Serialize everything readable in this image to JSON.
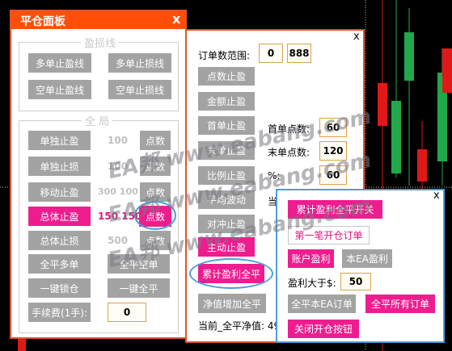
{
  "panel1": {
    "title": "平仓面板",
    "close": "x",
    "group1_label": "盈损线",
    "btn_multi_tp": "多单止盈线",
    "btn_multi_sl": "多单止损线",
    "btn_short_tp": "空单止盈线",
    "btn_short_sl": "空单止损线",
    "group2_label": "全 局",
    "row_single_tp": {
      "label": "单独止盈",
      "value": "100",
      "unit": "点数"
    },
    "row_single_sl": {
      "label": "单独止损",
      "value": "100",
      "unit": "点数"
    },
    "row_move_tp": {
      "label": "移动止盈",
      "value": "300 100",
      "unit": "点数"
    },
    "row_total_tp": {
      "label": "总体止盈",
      "value": "150 150",
      "unit": "点数"
    },
    "row_total_sl": {
      "label": "总体止损",
      "value": "500",
      "unit": "点数"
    },
    "btn_close_all_long": "全平多单",
    "btn_close_all_short": "全平空单",
    "btn_lock": "一键锁仓",
    "btn_close_all": "一键全平",
    "fee_label": "手续费(1手):",
    "fee_value": "0"
  },
  "panel2": {
    "close": "x",
    "range_label": "订单数范围:",
    "range_from": "0",
    "range_to": "888",
    "btn_points_tp": "点数止盈",
    "btn_amount_tp": "金额止盈",
    "btn_first_tp": "首单止盈",
    "first_points_label": "首单点数:",
    "first_points_value": "60",
    "btn_last_tp": "末单止盈",
    "last_points_label": "末单点数:",
    "last_points_value": "120",
    "btn_ratio_tp": "比例止盈",
    "ratio_label": "%:",
    "ratio_value": "60",
    "btn_avg_wave": "平均波动",
    "avg_label": "当",
    "btn_hedge_tp": "对冲止盈",
    "btn_active_tp": "主动止盈",
    "btn_cumulative": "累计盈利全平",
    "btn_net_increase": "净值增加全平",
    "current_label": "当前_全平净值: 49"
  },
  "panel3": {
    "close": "x",
    "btn_cum_toggle": "累计盈利全平开关",
    "btn_first_order": "第一笔开仓订单",
    "btn_account_profit": "账户盈利",
    "btn_ea_profit": "本EA盈利",
    "profit_gt_label": "盈利大于$:",
    "profit_gt_value": "50",
    "btn_close_ea_orders": "全平本EA订单",
    "btn_close_all_orders": "全平所有订单",
    "btn_close_open_btn": "关闭开仓按钮"
  },
  "watermark": "EA邦 www.eabang.com",
  "colors": {
    "title_bar": "#ff4e0a",
    "panel_border": "#e8502a",
    "pink_button": "#ee1d8f",
    "gray_button": "#a3a3a3",
    "highlight_circle": "#4a9ee0",
    "candle_red": "#e01818",
    "candle_green": "#21a84a"
  }
}
